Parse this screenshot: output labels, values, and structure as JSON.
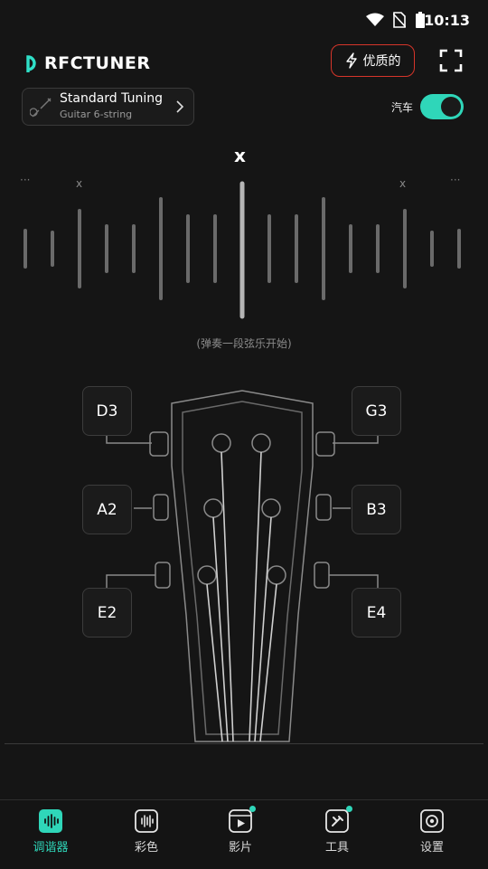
{
  "status": {
    "time": "10:13"
  },
  "header": {
    "logo_text_prefix": "P",
    "logo_text_main": "RFCTUNER",
    "premium_label": "优质的"
  },
  "tuning": {
    "name": "Standard Tuning",
    "sub": "Guitar 6-string"
  },
  "auto": {
    "label": "汽车",
    "enabled": true
  },
  "meter": {
    "center_mark": "x",
    "left_dots": "···",
    "right_dots": "···",
    "left_x": "x",
    "right_x": "x",
    "hint": "(弹奏一段弦乐开始)"
  },
  "strings": {
    "left": [
      "D3",
      "A2",
      "E2"
    ],
    "right": [
      "G3",
      "B3",
      "E4"
    ]
  },
  "nav": {
    "items": [
      {
        "label": "调谐器",
        "icon": "waveform-icon",
        "active": true
      },
      {
        "label": "彩色",
        "icon": "equalizer-icon"
      },
      {
        "label": "影片",
        "icon": "video-icon",
        "badge": true
      },
      {
        "label": "工具",
        "icon": "tools-icon",
        "badge": true
      },
      {
        "label": "设置",
        "icon": "settings-icon"
      }
    ]
  },
  "colors": {
    "accent": "#2fd6b9",
    "premium_border": "#d6352a",
    "background": "#151515"
  }
}
